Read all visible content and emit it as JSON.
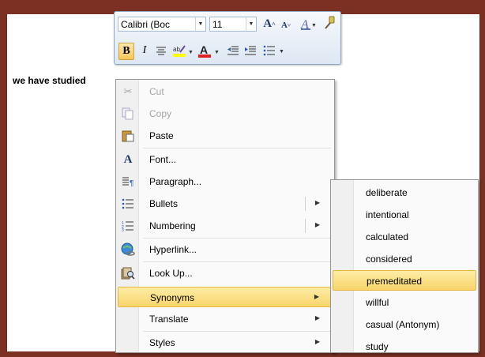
{
  "document": {
    "text": "we have studied"
  },
  "mini_toolbar": {
    "font_name": "Calibri (Boc",
    "font_size": "11",
    "grow_font_icon": "A",
    "shrink_font_icon": "A",
    "bold": "B",
    "italic": "I",
    "font_color_glyph": "A",
    "accent_bold": "#f8c65a"
  },
  "context_menu": {
    "items": [
      {
        "label": "Cut",
        "icon": "scissors-icon",
        "disabled": true
      },
      {
        "label": "Copy",
        "icon": "copy-icon",
        "disabled": true
      },
      {
        "label": "Paste",
        "icon": "paste-icon",
        "disabled": false
      },
      {
        "label": "Font...",
        "icon": "font-icon",
        "disabled": false
      },
      {
        "label": "Paragraph...",
        "icon": "paragraph-icon",
        "disabled": false
      },
      {
        "label": "Bullets",
        "icon": "bullets-icon",
        "disabled": false,
        "submenu": true
      },
      {
        "label": "Numbering",
        "icon": "numbering-icon",
        "disabled": false,
        "submenu": true
      },
      {
        "label": "Hyperlink...",
        "icon": "hyperlink-icon",
        "disabled": false
      },
      {
        "label": "Look Up...",
        "icon": "lookup-icon",
        "disabled": false
      },
      {
        "label": "Synonyms",
        "icon": "",
        "disabled": false,
        "submenu": true,
        "highlighted": true
      },
      {
        "label": "Translate",
        "icon": "",
        "disabled": false,
        "submenu": true
      },
      {
        "label": "Styles",
        "icon": "",
        "disabled": false,
        "submenu": true
      }
    ]
  },
  "synonyms_submenu": {
    "items": [
      {
        "label": "deliberate"
      },
      {
        "label": "intentional"
      },
      {
        "label": "calculated"
      },
      {
        "label": "considered"
      },
      {
        "label": "premeditated",
        "highlighted": true
      },
      {
        "label": "willful"
      },
      {
        "label": "casual (Antonym)"
      },
      {
        "label": "study"
      }
    ]
  },
  "colors": {
    "frame": "#7b3023",
    "highlight": "#f8d56b"
  }
}
